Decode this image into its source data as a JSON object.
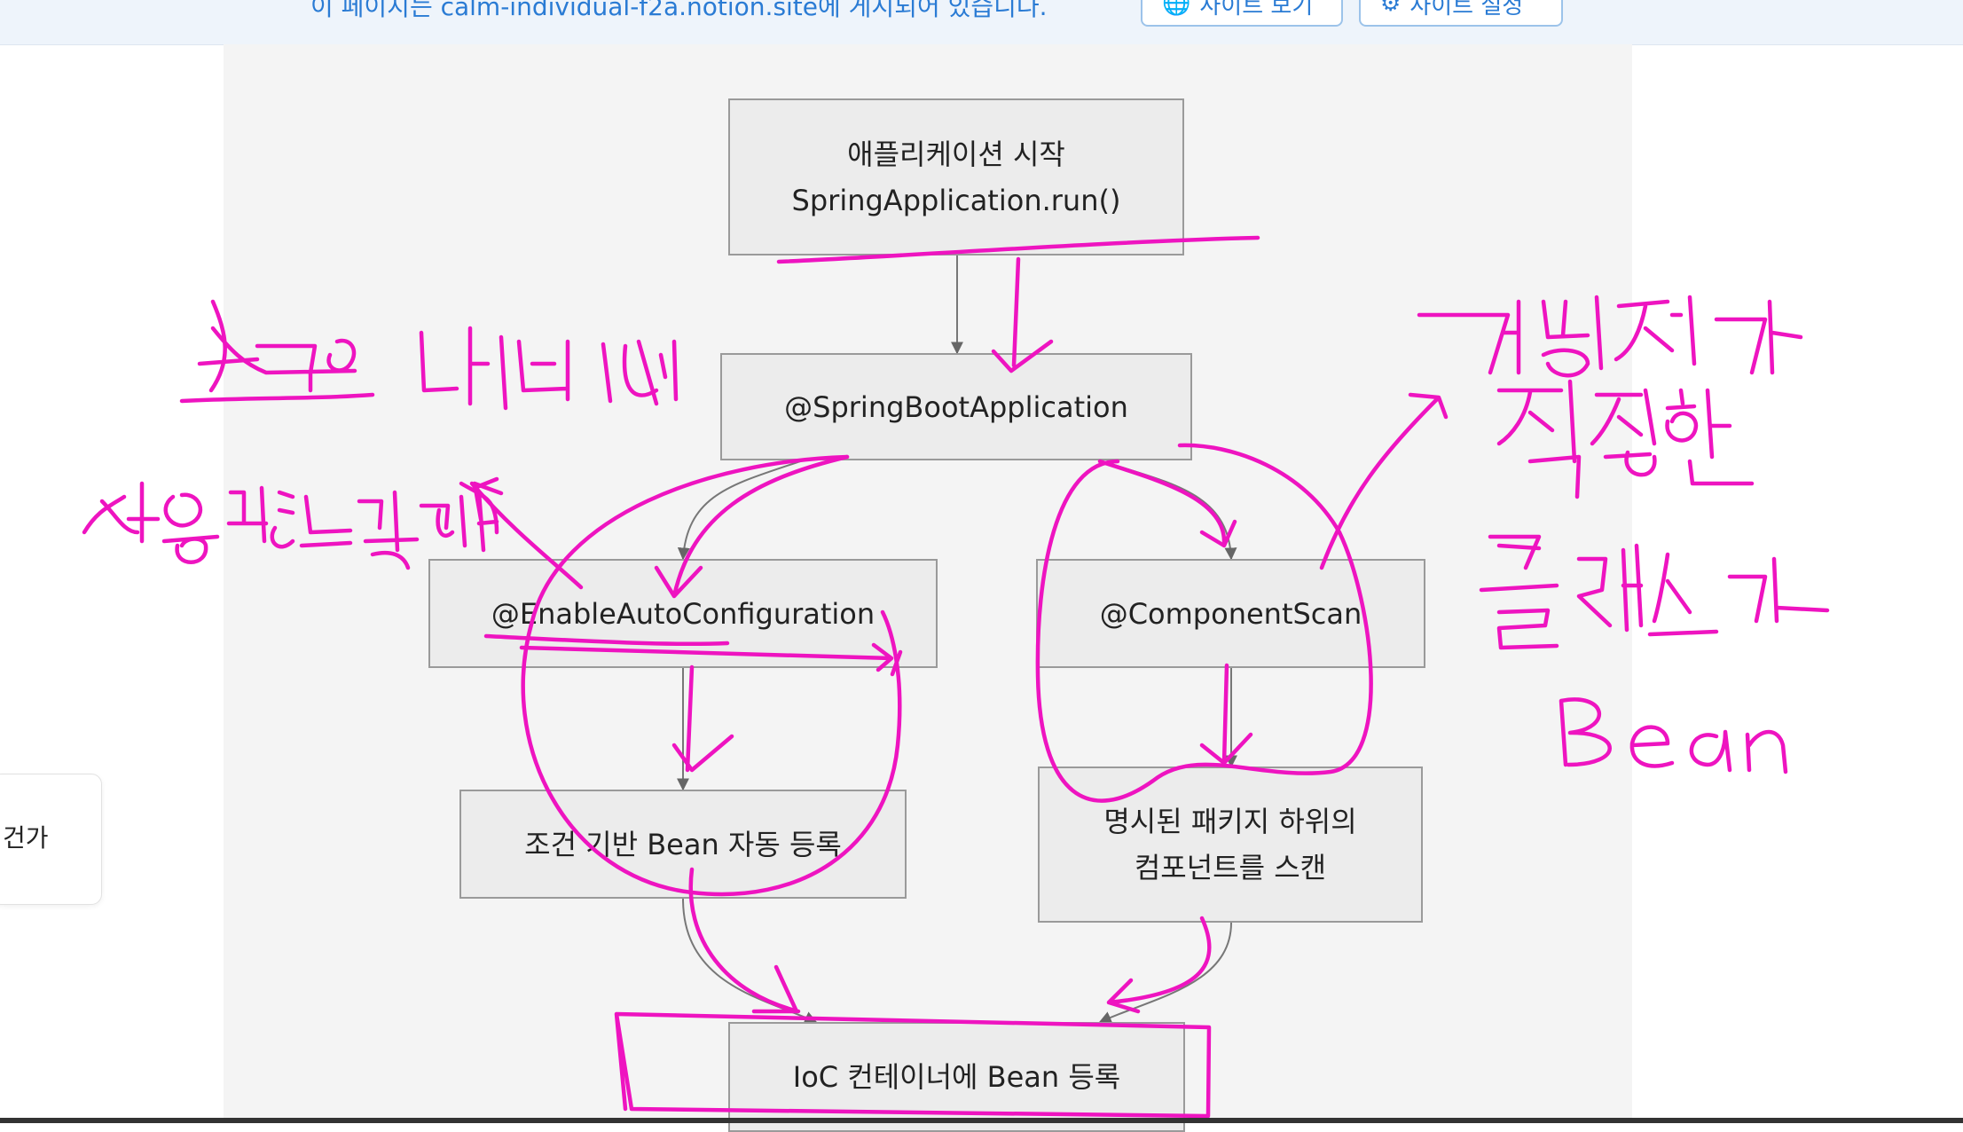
{
  "banner": {
    "notice": "이 페이지는 calm-individual-f2a.notion.site에 게시되어 있습니다.",
    "view_site_label": "사이트 보기",
    "view_site_icon": "globe-icon",
    "site_settings_label": "사이트 설정",
    "site_settings_icon": "gear-icon"
  },
  "side_card": {
    "text": "건가"
  },
  "diagram": {
    "nodes": {
      "start_line1": "애플리케이션 시작",
      "start_line2": "SpringApplication.run()",
      "springboot": "@SpringBootApplication",
      "enableauto": "@EnableAutoConfiguration",
      "componentscan": "@ComponentScan",
      "conditional": "조건 기반 Bean 자동 등록",
      "scan_line1": "명시된 패키지 하위의",
      "scan_line2": "컴포넌트를 스캔",
      "ioc": "IoC 컨테이너에 Bean 등록"
    },
    "colors": {
      "node_fill": "#ececec",
      "node_border": "#9a9a9a",
      "edge": "#777777",
      "ink": "#ee14c0",
      "background": "#f4f4f4"
    }
  },
  "handwriting": {
    "left_line1": "스프링 내부에서",
    "left_line2": "사용되는 객체",
    "right_line1": "개발자가",
    "right_line2": "직접 작성한",
    "right_line3": "클래스가",
    "right_line4": "Bean"
  }
}
